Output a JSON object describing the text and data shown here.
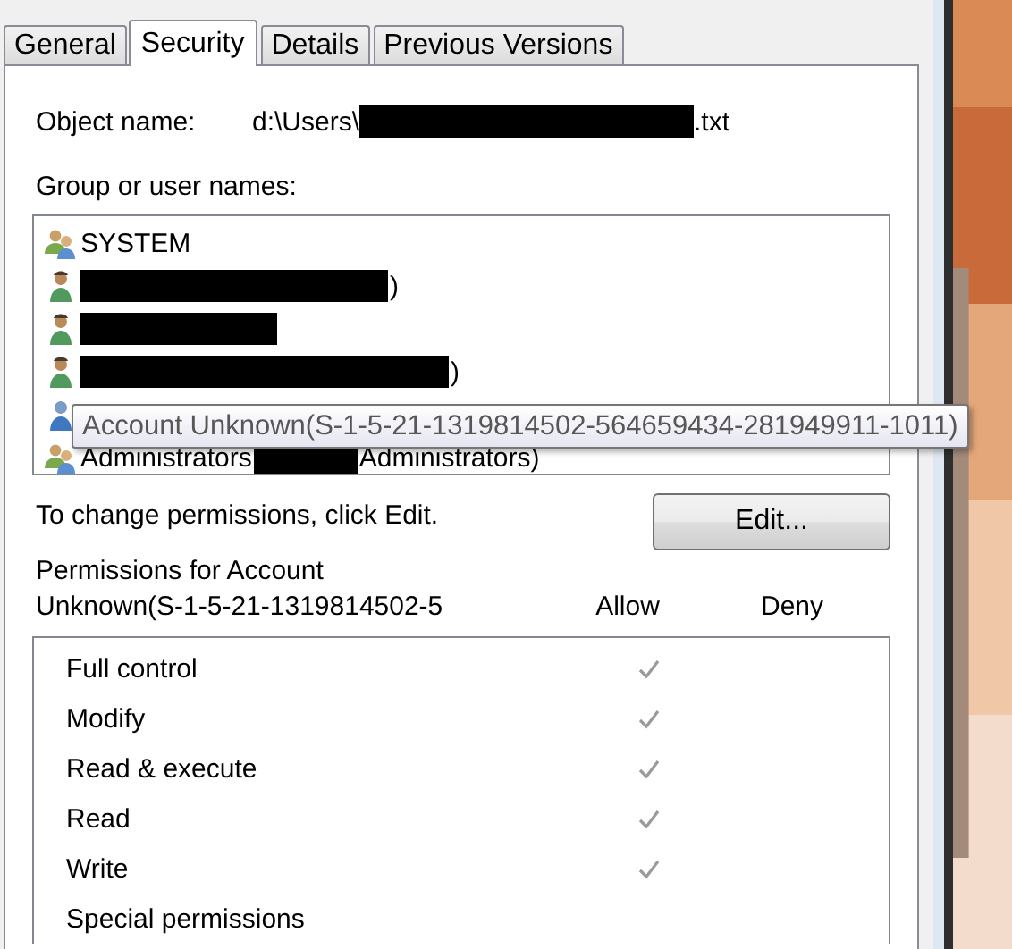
{
  "tabs": [
    {
      "label": "General",
      "selected": false
    },
    {
      "label": "Security",
      "selected": true
    },
    {
      "label": "Details",
      "selected": false
    },
    {
      "label": "Previous Versions",
      "selected": false
    }
  ],
  "object_name": {
    "label": "Object name:",
    "value_parts": [
      {
        "kind": "text",
        "text": "d:\\Users\\"
      },
      {
        "kind": "redacted"
      },
      {
        "kind": "text",
        "text": ".txt"
      }
    ]
  },
  "group_label": "Group or user names:",
  "users": [
    {
      "kind": "group",
      "parts": [
        {
          "kind": "text",
          "text": "SYSTEM"
        }
      ]
    },
    {
      "kind": "user",
      "parts": [
        {
          "kind": "redacted"
        },
        {
          "kind": "text",
          "text": ")"
        }
      ]
    },
    {
      "kind": "user",
      "parts": [
        {
          "kind": "redacted"
        }
      ]
    },
    {
      "kind": "user",
      "parts": [
        {
          "kind": "redacted"
        },
        {
          "kind": "text",
          "text": ")"
        }
      ]
    },
    {
      "kind": "unknown"
    },
    {
      "kind": "group",
      "parts": [
        {
          "kind": "text",
          "text": "Administrators"
        },
        {
          "kind": "redacted"
        },
        {
          "kind": "text",
          "text": "Administrators)"
        }
      ]
    }
  ],
  "tooltip": "Account Unknown(S-1-5-21-1319814502-564659434-281949911-1011)",
  "change_hint": "To change permissions, click Edit.",
  "edit_button": "Edit...",
  "permissions_label": [
    "Permissions for Account",
    "Unknown(S-1-5-21-1319814502-5"
  ],
  "columns": [
    "Allow",
    "Deny"
  ],
  "permissions": [
    {
      "name": "Full control",
      "allow": true,
      "deny": false
    },
    {
      "name": "Modify",
      "allow": true,
      "deny": false
    },
    {
      "name": "Read & execute",
      "allow": true,
      "deny": false
    },
    {
      "name": "Read",
      "allow": true,
      "deny": false
    },
    {
      "name": "Write",
      "allow": true,
      "deny": false
    },
    {
      "name": "Special permissions",
      "allow": false,
      "deny": false
    }
  ]
}
